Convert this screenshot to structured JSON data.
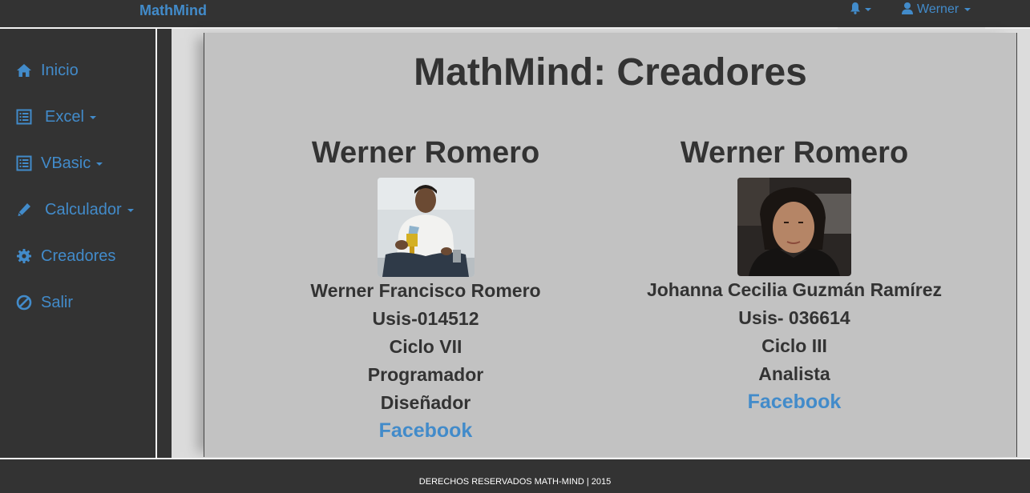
{
  "navbar": {
    "brand": "MathMind",
    "notifications_icon": "bell-icon",
    "user_icon": "user-icon",
    "user_name": "Werner"
  },
  "sidebar": {
    "items": [
      {
        "label": "Inicio",
        "icon": "home-icon"
      },
      {
        "label": "Excel",
        "icon": "list-icon",
        "dropdown": true
      },
      {
        "label": "VBasic",
        "icon": "list-icon",
        "dropdown": true
      },
      {
        "label": "Calculador",
        "icon": "pencil-icon",
        "dropdown": true
      },
      {
        "label": "Creadores",
        "icon": "gear-icon"
      },
      {
        "label": "Salir",
        "icon": "ban-icon"
      }
    ]
  },
  "main": {
    "title": "MathMind: Creadores",
    "creators": [
      {
        "heading": "Werner Romero",
        "full_name": "Werner Francisco Romero",
        "id": "Usis-014512",
        "cycle": "Ciclo VII",
        "roles": [
          "Programador",
          "Diseñador"
        ],
        "link": "Facebook"
      },
      {
        "heading": "Werner Romero",
        "full_name": "Johanna Cecilia Guzmán Ramírez",
        "id": "Usis- 036614",
        "cycle": "Ciclo III",
        "roles": [
          "Analista"
        ],
        "link": "Facebook"
      }
    ]
  },
  "footer": {
    "text": "DERECHOS RESERVADOS MATH-MIND | 2015"
  },
  "colors": {
    "accent": "#428bca",
    "nav_bg": "#333333",
    "panel_bg": "#c2c2c2",
    "text": "#333333"
  }
}
